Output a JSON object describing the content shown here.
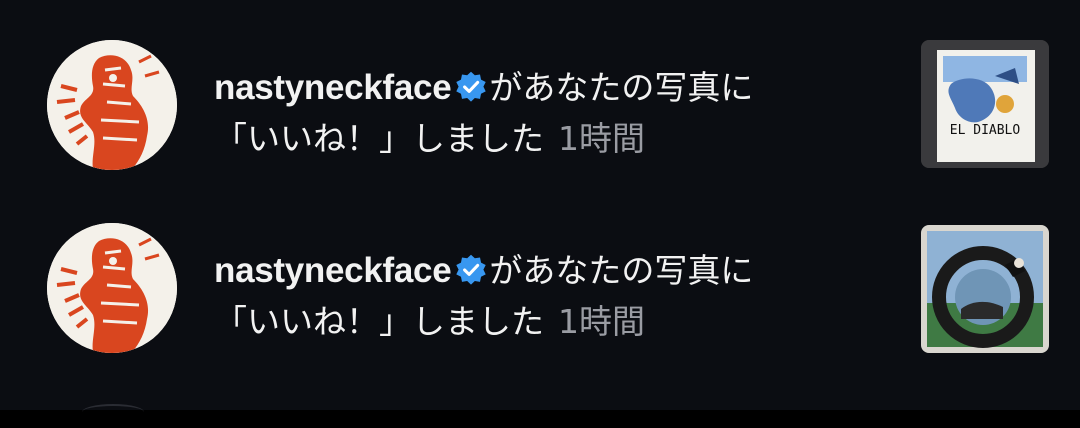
{
  "notifications": [
    {
      "username": "nastyneckface",
      "action_line1": "があなたの写真に",
      "action_line2": "「いいね！」しました",
      "time": "1時間",
      "post_text": "EL DIABLO"
    },
    {
      "username": "nastyneckface",
      "action_line1": "があなたの写真に",
      "action_line2": "「いいね！」しました",
      "time": "1時間"
    }
  ],
  "colors": {
    "background": "#0b0d12",
    "verified_badge": "#3897f0",
    "timestamp": "#9a9ca3",
    "avatar_art": "#d9461f"
  },
  "icons": {
    "verified": "verified-badge-icon"
  }
}
